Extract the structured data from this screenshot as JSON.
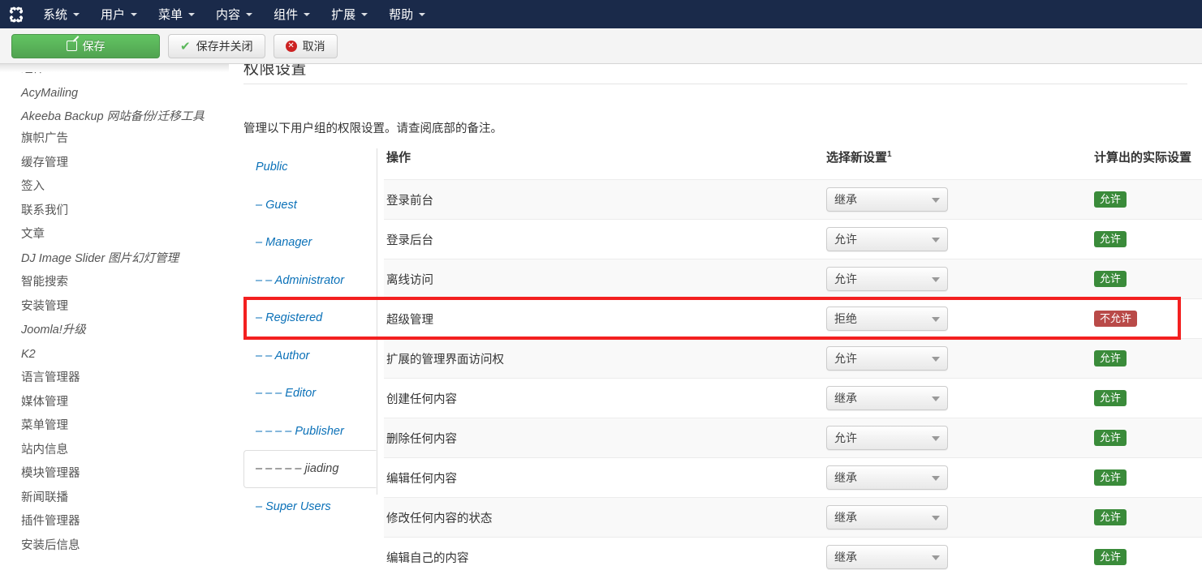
{
  "topnav": {
    "logo": "joomla-logo",
    "items": [
      {
        "label": "系统"
      },
      {
        "label": "用户"
      },
      {
        "label": "菜单"
      },
      {
        "label": "内容"
      },
      {
        "label": "组件"
      },
      {
        "label": "扩展"
      },
      {
        "label": "帮助"
      }
    ]
  },
  "toolbar": {
    "save_label": "保存",
    "save_close_label": "保存并关闭",
    "cancel_label": "取消"
  },
  "sidebar": {
    "items": [
      {
        "label": "组件",
        "latin": false,
        "cut": true
      },
      {
        "label": "AcyMailing",
        "latin": true
      },
      {
        "label": "Akeeba Backup 网站备份/迁移工具",
        "latin": true,
        "wrap": true
      },
      {
        "label": "旗帜广告",
        "latin": false
      },
      {
        "label": "缓存管理",
        "latin": false
      },
      {
        "label": "签入",
        "latin": false
      },
      {
        "label": "联系我们",
        "latin": false
      },
      {
        "label": "文章",
        "latin": false
      },
      {
        "label": "DJ Image Slider 图片幻灯管理",
        "latin": true
      },
      {
        "label": "智能搜索",
        "latin": false
      },
      {
        "label": "安装管理",
        "latin": false
      },
      {
        "label": "Joomla!升级",
        "latin": true
      },
      {
        "label": "K2",
        "latin": true
      },
      {
        "label": "语言管理器",
        "latin": false
      },
      {
        "label": "媒体管理",
        "latin": false
      },
      {
        "label": "菜单管理",
        "latin": false
      },
      {
        "label": "站内信息",
        "latin": false
      },
      {
        "label": "模块管理器",
        "latin": false
      },
      {
        "label": "新闻联播",
        "latin": false
      },
      {
        "label": "插件管理器",
        "latin": false
      },
      {
        "label": "安装后信息",
        "latin": false
      }
    ]
  },
  "main": {
    "heading": "权限设置",
    "intro": "管理以下用户组的权限设置。请查阅底部的备注。"
  },
  "groups": {
    "tabs": [
      {
        "label": "Public",
        "active": false
      },
      {
        "label": "– Guest",
        "active": false
      },
      {
        "label": "– Manager",
        "active": false
      },
      {
        "label": "– – Administrator",
        "active": false
      },
      {
        "label": "– Registered",
        "active": false
      },
      {
        "label": "– – Author",
        "active": false
      },
      {
        "label": "– – – Editor",
        "active": false
      },
      {
        "label": "– – – – Publisher",
        "active": false
      },
      {
        "label": "– – – – – jiading",
        "active": true
      },
      {
        "label": "– Super Users",
        "active": false
      }
    ]
  },
  "permissions": {
    "headers": {
      "action": "操作",
      "setting": "选择新设置",
      "setting_sup": "1",
      "calculated": "计算出的实际设置"
    },
    "rows": [
      {
        "action": "登录前台",
        "setting": "继承",
        "calculated": "允许",
        "state": "allow"
      },
      {
        "action": "登录后台",
        "setting": "允许",
        "calculated": "允许",
        "state": "allow"
      },
      {
        "action": "离线访问",
        "setting": "允许",
        "calculated": "允许",
        "state": "allow"
      },
      {
        "action": "超级管理",
        "setting": "拒绝",
        "calculated": "不允许",
        "state": "deny"
      },
      {
        "action": "扩展的管理界面访问权",
        "setting": "允许",
        "calculated": "允许",
        "state": "allow"
      },
      {
        "action": "创建任何内容",
        "setting": "继承",
        "calculated": "允许",
        "state": "allow"
      },
      {
        "action": "删除任何内容",
        "setting": "允许",
        "calculated": "允许",
        "state": "allow"
      },
      {
        "action": "编辑任何内容",
        "setting": "继承",
        "calculated": "允许",
        "state": "allow"
      },
      {
        "action": "修改任何内容的状态",
        "setting": "继承",
        "calculated": "允许",
        "state": "allow"
      },
      {
        "action": "编辑自己的内容",
        "setting": "继承",
        "calculated": "允许",
        "state": "allow"
      }
    ]
  },
  "colors": {
    "navbar": "#1a2a4a",
    "save_green": "#51a351",
    "link_blue": "#0b71b8",
    "badge_allow": "#3a8b3a",
    "badge_deny": "#b94a48",
    "annotation_red": "#f32020"
  }
}
